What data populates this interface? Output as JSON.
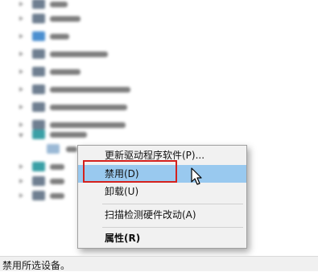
{
  "context_menu": {
    "items": [
      {
        "label": "更新驱动程序软件(P)...",
        "highlighted": false,
        "bold": false
      },
      {
        "label": "禁用(D)",
        "highlighted": true,
        "bold": false
      },
      {
        "label": "卸载(U)",
        "highlighted": false,
        "bold": false
      },
      {
        "label": "扫描检测硬件改动(A)",
        "highlighted": false,
        "bold": false
      },
      {
        "label": "属性(R)",
        "highlighted": false,
        "bold": true
      }
    ],
    "highlight_color": "#99c9ef",
    "callout_color": "#d4211d"
  },
  "status_bar": {
    "text": "禁用所选设备。"
  },
  "tree": {
    "note_icons": [
      "device-category-icon",
      "network-adapter-icon"
    ]
  }
}
